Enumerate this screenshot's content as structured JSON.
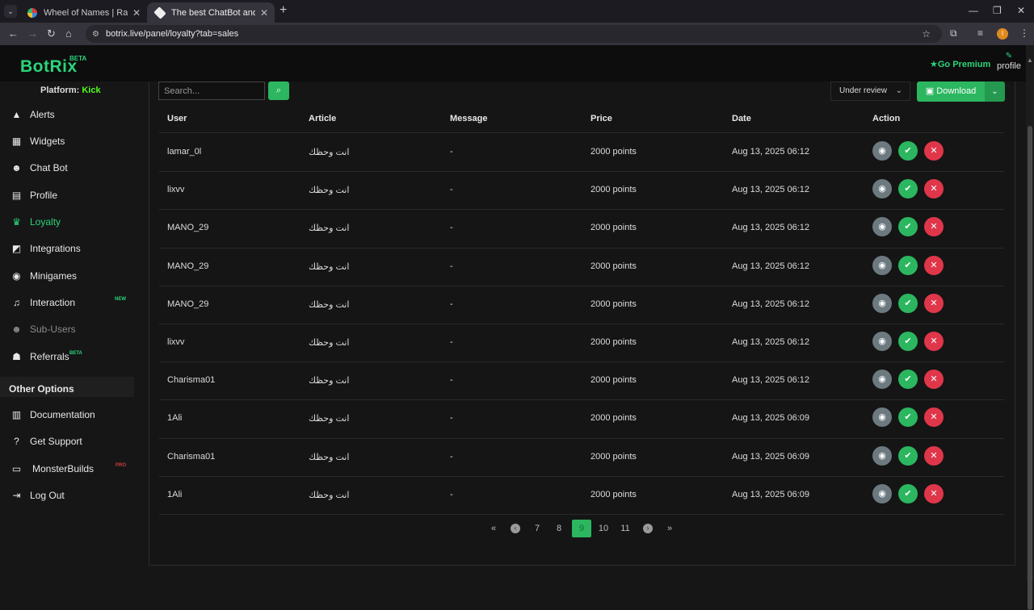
{
  "browser": {
    "tabs": [
      {
        "title": "Wheel of Names | Random name picker",
        "active": false
      },
      {
        "title": "The best ChatBot and Widgets for Kick",
        "active": true
      }
    ],
    "url": "botrix.live/panel/loyalty?tab=sales",
    "profile_initial": "I"
  },
  "header": {
    "logo": "BotRix",
    "beta": "BETA",
    "go_premium": "Go Premium",
    "profile": "profile"
  },
  "sidebar": {
    "platform_label": "Platform:",
    "platform_value": "Kick",
    "items": [
      {
        "label": "Alerts",
        "icon": "warning-icon"
      },
      {
        "label": "Widgets",
        "icon": "grid-icon"
      },
      {
        "label": "Chat Bot",
        "icon": "robot-icon"
      },
      {
        "label": "Profile",
        "icon": "id-card-icon"
      },
      {
        "label": "Loyalty",
        "icon": "trophy-icon",
        "active": true
      },
      {
        "label": "Integrations",
        "icon": "puzzle-icon"
      },
      {
        "label": "Minigames",
        "icon": "gamepad-icon"
      },
      {
        "label": "Interaction",
        "icon": "music-icon",
        "tag": "NEW"
      },
      {
        "label": "Sub-Users",
        "icon": "users-icon",
        "disabled": true
      },
      {
        "label": "Referrals",
        "icon": "user-group-icon",
        "tag": "BETA"
      }
    ],
    "other_options": "Other Options",
    "other_items": [
      {
        "label": "Documentation",
        "icon": "book-icon"
      },
      {
        "label": "Get Support",
        "icon": "question-icon"
      },
      {
        "label": "MonsterBuilds",
        "icon": "laptop-icon",
        "tag": "PRO"
      },
      {
        "label": "Log Out",
        "icon": "logout-icon"
      }
    ]
  },
  "toolbar": {
    "search_placeholder": "Search...",
    "filter_value": "Under review",
    "download_label": "Download"
  },
  "table": {
    "columns": [
      "User",
      "Article",
      "Message",
      "Price",
      "Date",
      "Action"
    ],
    "rows": [
      {
        "user": "lamar_0l",
        "article": "انت وحظك",
        "message": "-",
        "price": "2000 points",
        "date": "Aug 13, 2025 06:12"
      },
      {
        "user": "lixvv",
        "article": "انت وحظك",
        "message": "-",
        "price": "2000 points",
        "date": "Aug 13, 2025 06:12"
      },
      {
        "user": "MANO_29",
        "article": "انت وحظك",
        "message": "-",
        "price": "2000 points",
        "date": "Aug 13, 2025 06:12"
      },
      {
        "user": "MANO_29",
        "article": "انت وحظك",
        "message": "-",
        "price": "2000 points",
        "date": "Aug 13, 2025 06:12"
      },
      {
        "user": "MANO_29",
        "article": "انت وحظك",
        "message": "-",
        "price": "2000 points",
        "date": "Aug 13, 2025 06:12"
      },
      {
        "user": "lixvv",
        "article": "انت وحظك",
        "message": "-",
        "price": "2000 points",
        "date": "Aug 13, 2025 06:12"
      },
      {
        "user": "Charisma01",
        "article": "انت وحظك",
        "message": "-",
        "price": "2000 points",
        "date": "Aug 13, 2025 06:12"
      },
      {
        "user": "1Ali",
        "article": "انت وحظك",
        "message": "-",
        "price": "2000 points",
        "date": "Aug 13, 2025 06:09"
      },
      {
        "user": "Charisma01",
        "article": "انت وحظك",
        "message": "-",
        "price": "2000 points",
        "date": "Aug 13, 2025 06:09"
      },
      {
        "user": "1Ali",
        "article": "انت وحظك",
        "message": "-",
        "price": "2000 points",
        "date": "Aug 13, 2025 06:09"
      }
    ]
  },
  "pagination": {
    "pages": [
      "7",
      "8",
      "9",
      "10",
      "11"
    ],
    "current": "9"
  },
  "colors": {
    "accent": "#2bb65f",
    "brand": "#2bd47a",
    "danger": "#e0364a",
    "kick": "#53fc18"
  }
}
